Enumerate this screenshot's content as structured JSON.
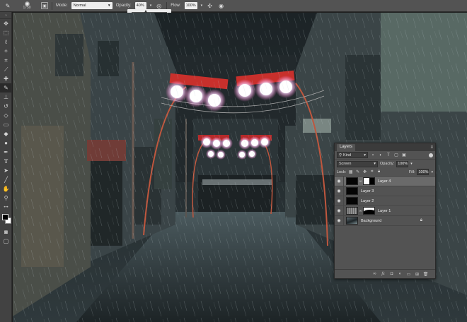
{
  "options_bar": {
    "brush_size": "1750",
    "mode_label": "Mode:",
    "mode_value": "Normal",
    "opacity_label": "Opacity:",
    "opacity_value": "40%",
    "flow_label": "Flow:",
    "flow_value": "100%",
    "opacity_slider_level": 0.4
  },
  "tools": [
    "move-tool",
    "marquee-tool",
    "lasso-tool",
    "quick-select-tool",
    "crop-tool",
    "eyedropper-tool",
    "healing-tool",
    "brush-tool",
    "clone-stamp-tool",
    "history-brush-tool",
    "eraser-tool",
    "gradient-tool",
    "blur-tool",
    "dodge-tool",
    "pen-tool",
    "type-tool",
    "path-select-tool",
    "shape-tool",
    "hand-tool",
    "zoom-tool"
  ],
  "colors": {
    "foreground": "#000000",
    "background": "#ffffff",
    "panel": "#535353",
    "selected_layer": "#6a6a6a"
  },
  "layers_panel": {
    "tab_label": "Layers",
    "filter_kind": "Kind",
    "blend_mode": "Screen",
    "opacity_label": "Opacity:",
    "opacity_value": "100%",
    "lock_label": "Lock:",
    "fill_label": "Fill:",
    "fill_value": "100%",
    "layers": [
      {
        "name": "Layer 4",
        "selected": true
      },
      {
        "name": "Layer 3",
        "selected": false
      },
      {
        "name": "Layer 2",
        "selected": false
      },
      {
        "name": "Layer 1",
        "selected": false
      },
      {
        "name": "Background",
        "selected": false
      }
    ]
  }
}
